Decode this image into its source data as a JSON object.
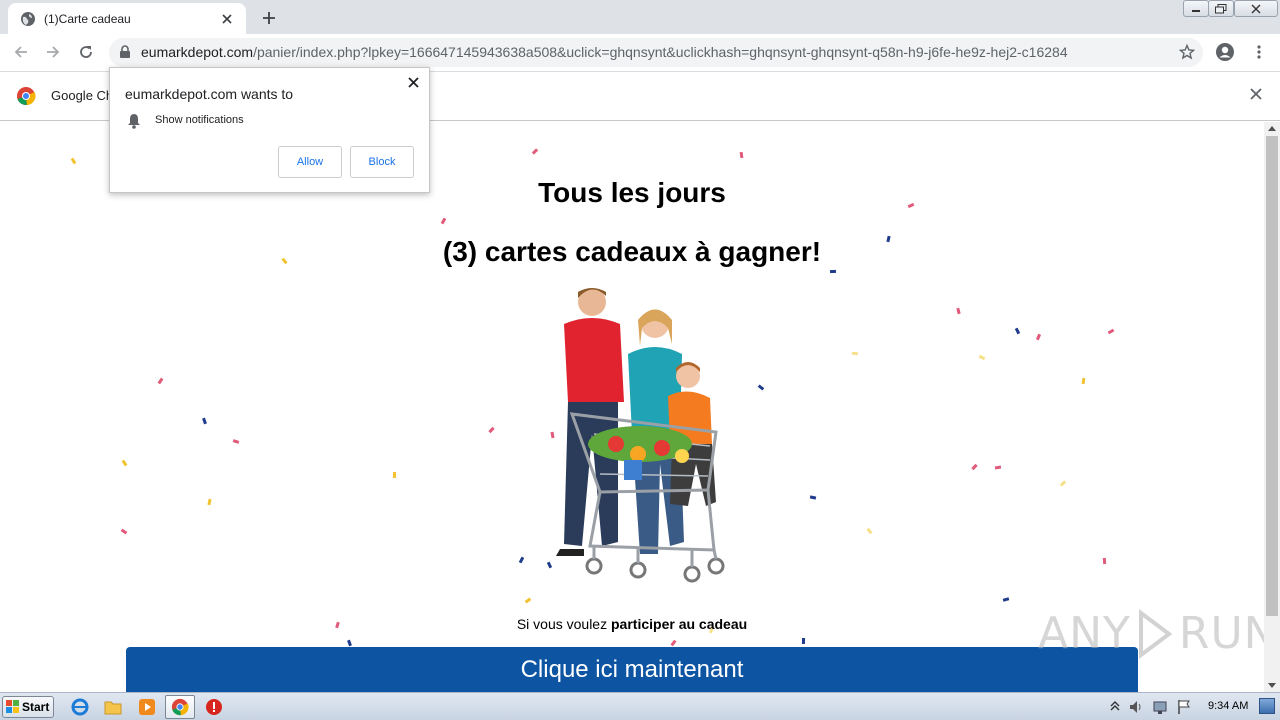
{
  "browser": {
    "tab": {
      "title": "(1)Carte cadeau"
    },
    "address": {
      "domain": "eumarkdepot.com",
      "path": "/panier/index.php?lpkey=16664714594363​8a508&uclick=ghqnsynt&uclickhash=ghqnsynt-ghqnsynt-q58n-h9-j6fe-he9z-hej2-c16284"
    },
    "infobar": {
      "text": "Google Ch"
    }
  },
  "permission_popup": {
    "title": "eumarkdepot.com wants to",
    "permission": "Show notifications",
    "allow_label": "Allow",
    "block_label": "Block"
  },
  "page": {
    "headline": "Tous les jours",
    "subheadline": "(3) cartes cadeaux à gagner!",
    "hero_alt": "family with shopping cart",
    "cta_intro": "Si vous voulez ",
    "cta_intro_bold": "participer au cadeau",
    "cta_button": "Clique ici maintenant",
    "watermark_left": "ANY",
    "watermark_right": "RUN"
  },
  "taskbar": {
    "start_label": "Start",
    "clock": "9:34 AM"
  },
  "colors": {
    "cta": "#0d55a3",
    "confetti": [
      "#e05a7a",
      "#f2c230",
      "#1f3b8c",
      "#f4a6b6",
      "#f7e08a"
    ]
  }
}
